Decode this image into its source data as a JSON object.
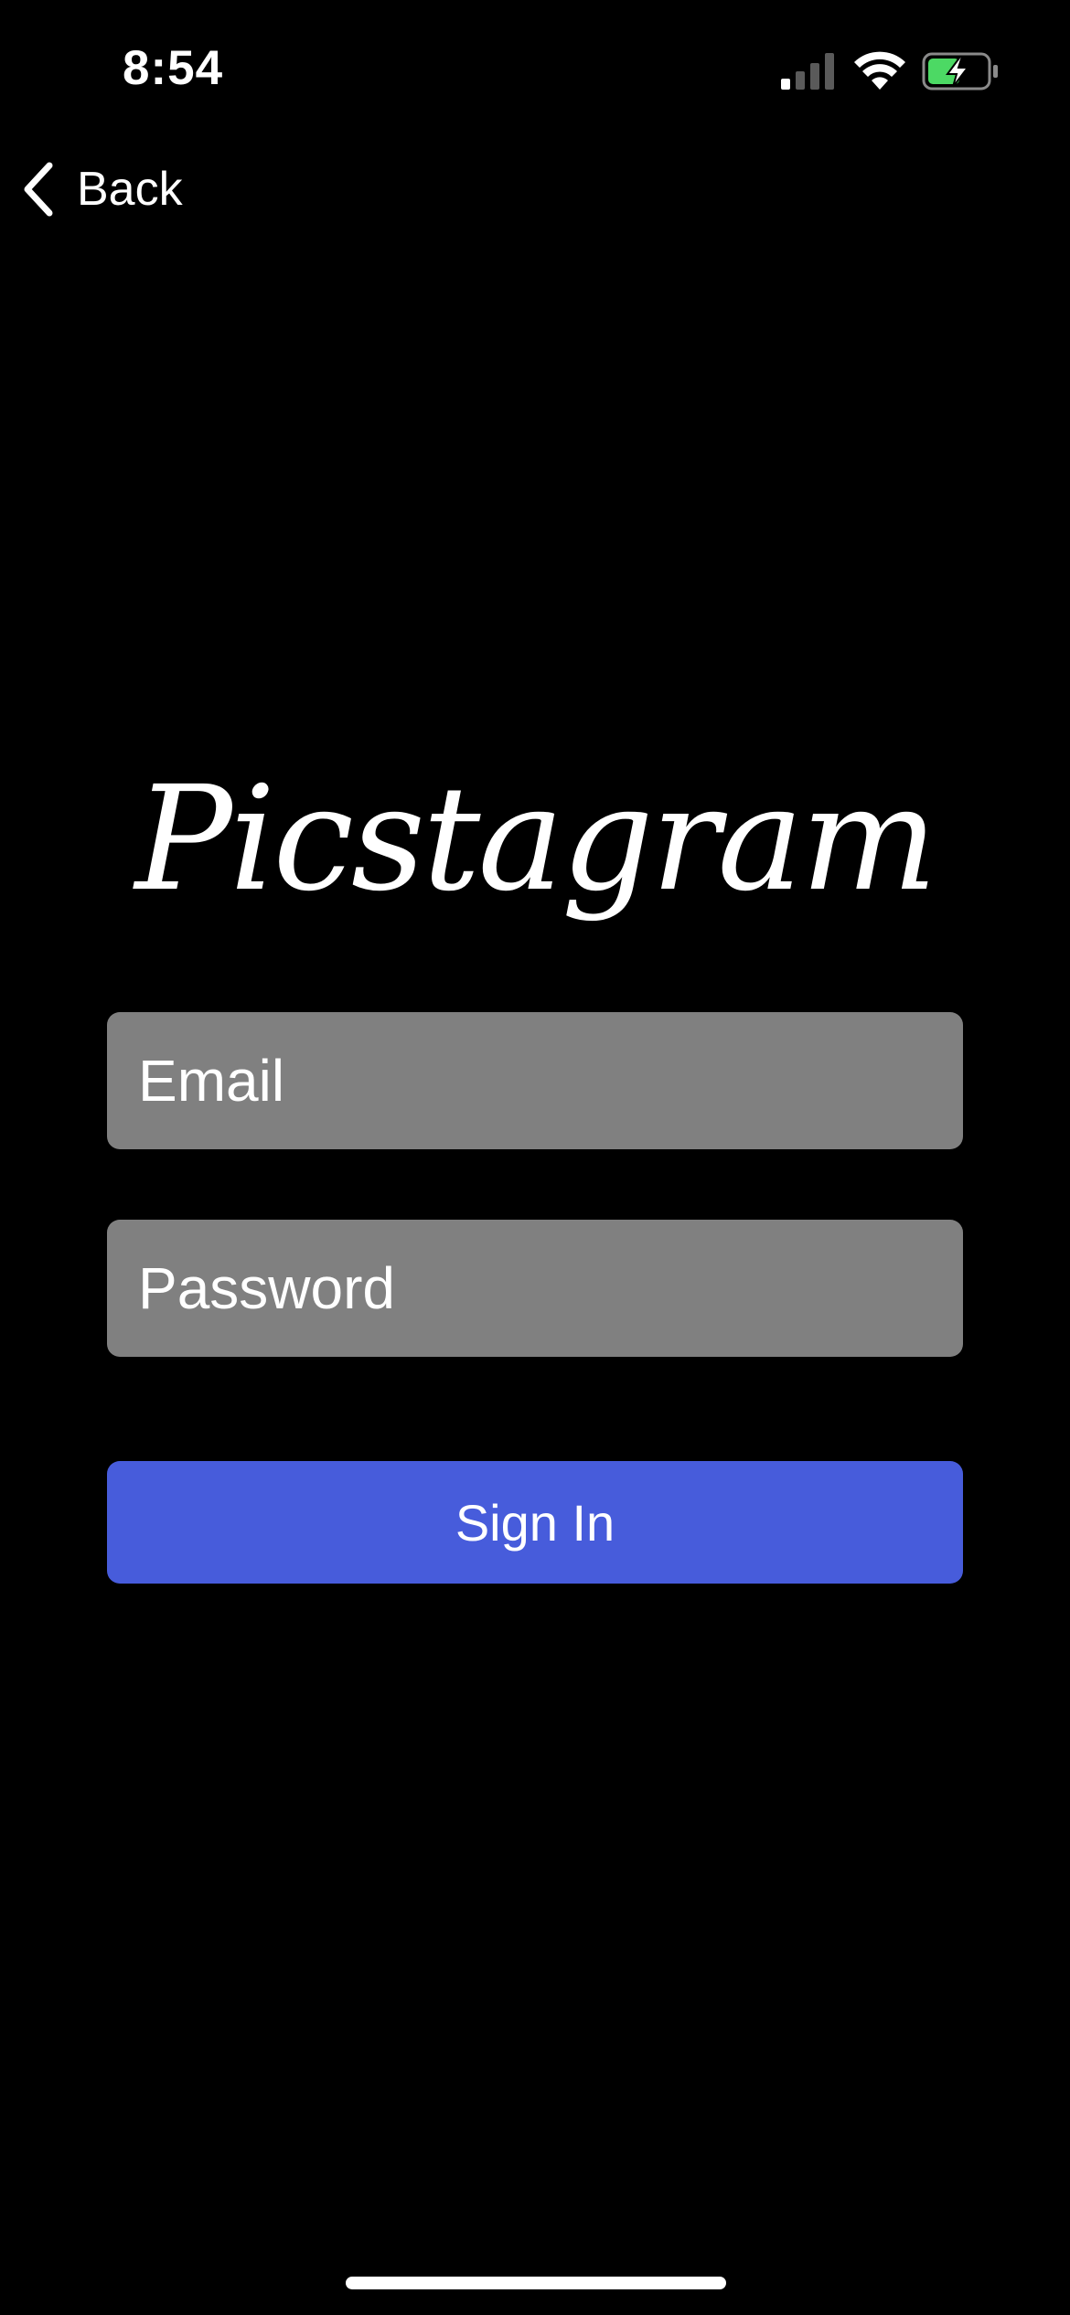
{
  "status_bar": {
    "time": "8:54",
    "signal_icon": "cellular-signal-icon",
    "wifi_icon": "wifi-icon",
    "battery_icon": "battery-charging-icon",
    "battery_color": "#4cd964",
    "signal_bars_active": 1,
    "signal_bars_total": 4
  },
  "nav": {
    "back_icon": "chevron-left-icon",
    "back_label": "Back"
  },
  "logo": {
    "text": "Picstagram"
  },
  "form": {
    "email_placeholder": "Email",
    "email_value": "",
    "password_placeholder": "Password",
    "password_value": "",
    "sign_in_label": "Sign In",
    "button_color": "#475cdb",
    "field_color": "#808080"
  }
}
